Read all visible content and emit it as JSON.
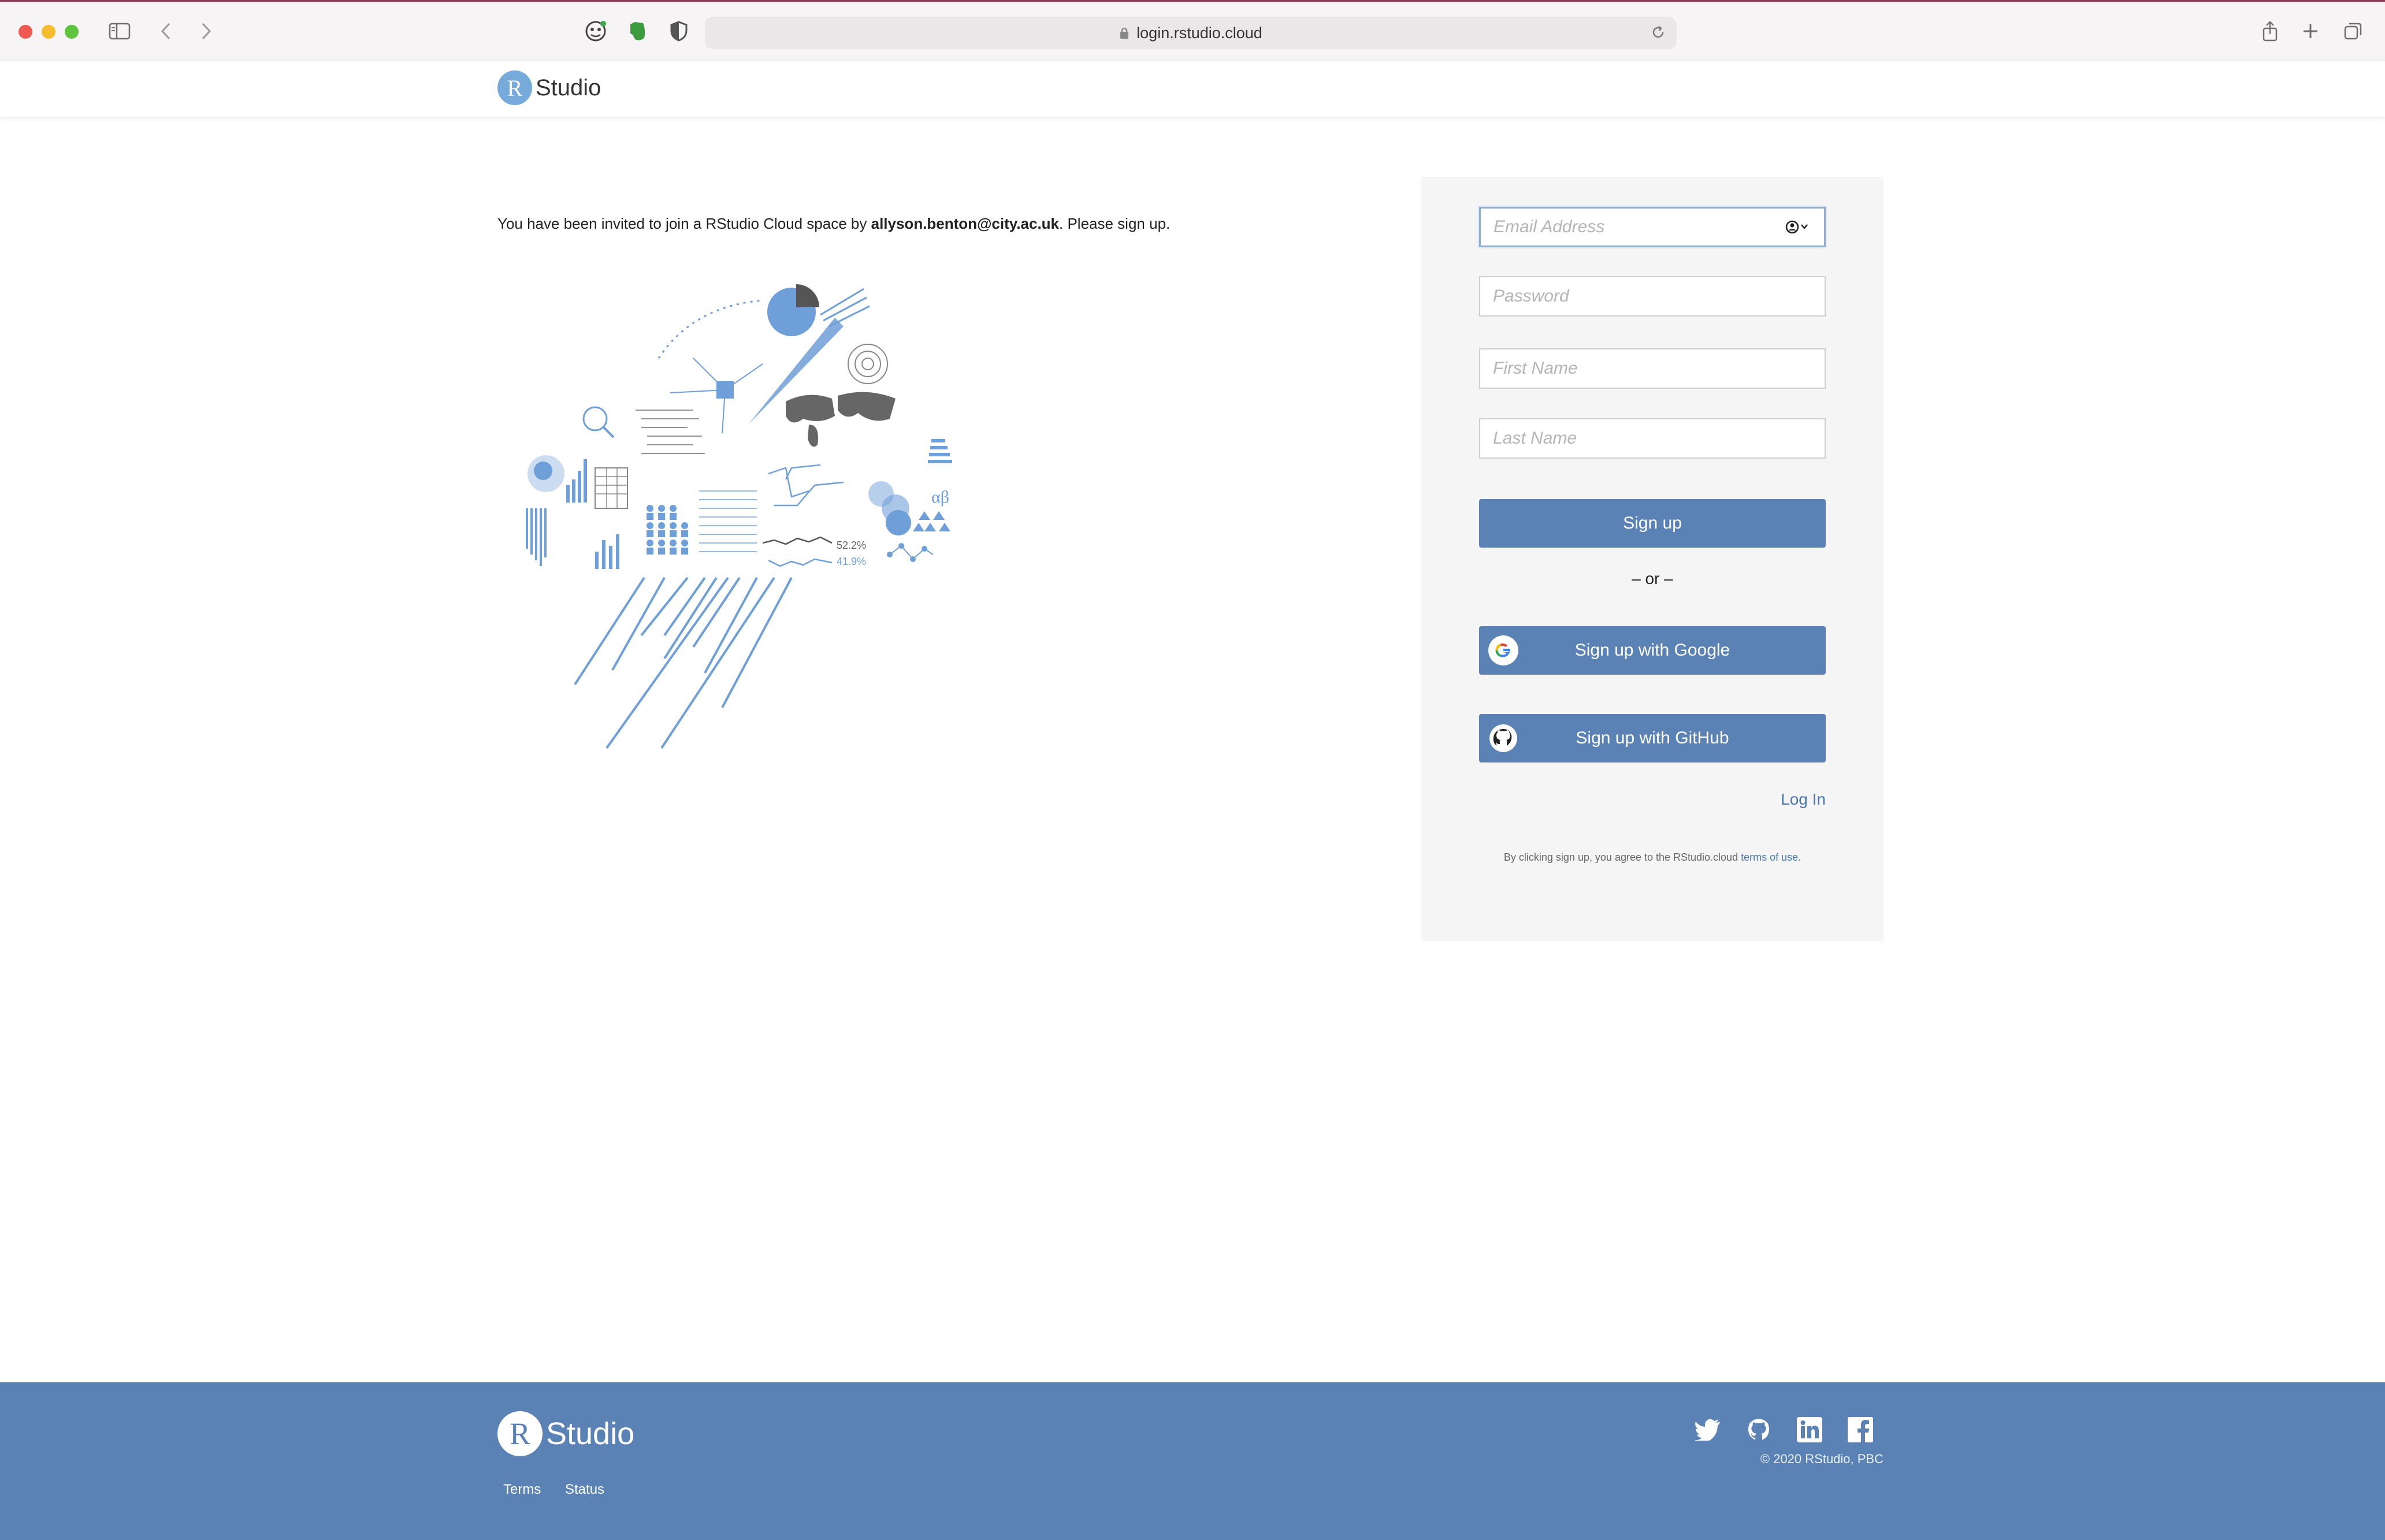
{
  "browser": {
    "url": "login.rstudio.cloud",
    "icons": [
      "sidebar-icon",
      "back-icon",
      "forward-icon",
      "extension-face-icon",
      "evernote-icon",
      "privacy-shield-icon",
      "lock-icon",
      "reload-icon",
      "share-icon",
      "new-tab-icon",
      "tabs-overview-icon"
    ]
  },
  "header": {
    "logo_letter": "R",
    "logo_text": "Studio"
  },
  "main": {
    "invite_prefix": "You have been invited to join a RStudio Cloud space by ",
    "invite_email": "allyson.benton@city.ac.uk",
    "invite_suffix": ". Please sign up.",
    "illustration_labels": {
      "pct1": "52.2%",
      "pct2": "41.9%",
      "greek": "αβ"
    }
  },
  "signup": {
    "email_placeholder": "Email Address",
    "password_placeholder": "Password",
    "first_name_placeholder": "First Name",
    "last_name_placeholder": "Last Name",
    "signup_label": "Sign up",
    "or_label": "– or –",
    "google_label": "Sign up with Google",
    "github_label": "Sign up with GitHub",
    "login_label": "Log In",
    "terms_prefix": "By clicking sign up, you agree to the RStudio.cloud ",
    "terms_link": "terms of use",
    "terms_suffix": "."
  },
  "footer": {
    "logo_letter": "R",
    "logo_text": "Studio",
    "links": [
      "Terms",
      "Status"
    ],
    "social": [
      "twitter-icon",
      "github-icon",
      "linkedin-icon",
      "facebook-icon"
    ],
    "copyright": "© 2020 RStudio, PBC"
  },
  "colors": {
    "brand_blue": "#5a82b4",
    "logo_blue": "#75aadb",
    "button_blue": "#5b82b5",
    "panel_bg": "#f5f5f5"
  }
}
